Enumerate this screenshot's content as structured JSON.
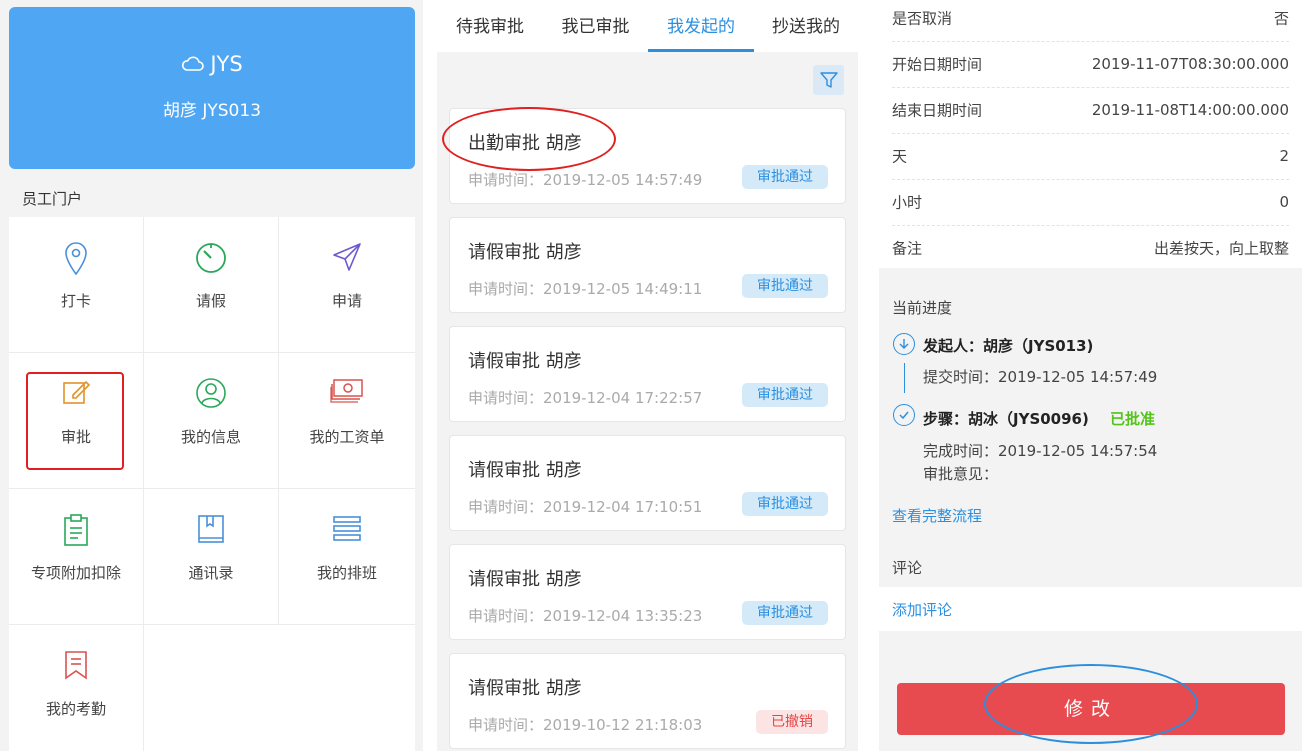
{
  "left": {
    "brand": "JYS",
    "user": "胡彦 JYS013",
    "section_label": "员工门户",
    "tiles": [
      {
        "label": "打卡",
        "icon": "location-pin-icon"
      },
      {
        "label": "请假",
        "icon": "timer-icon"
      },
      {
        "label": "申请",
        "icon": "send-icon"
      },
      {
        "label": "审批",
        "icon": "edit-icon"
      },
      {
        "label": "我的信息",
        "icon": "user-icon"
      },
      {
        "label": "我的工资单",
        "icon": "money-icon"
      },
      {
        "label": "专项附加扣除",
        "icon": "clipboard-icon"
      },
      {
        "label": "通讯录",
        "icon": "book-icon"
      },
      {
        "label": "我的排班",
        "icon": "schedule-icon"
      },
      {
        "label": "我的考勤",
        "icon": "bookmark-icon"
      }
    ]
  },
  "middle": {
    "tabs": [
      {
        "label": "待我审批"
      },
      {
        "label": "我已审批"
      },
      {
        "label": "我发起的"
      },
      {
        "label": "抄送我的"
      }
    ],
    "active_tab": "我发起的",
    "cards": [
      {
        "title": "出勤审批 胡彦",
        "meta": "申请时间：2019-12-05 14:57:49",
        "status": "审批通过",
        "status_type": "ok"
      },
      {
        "title": "请假审批 胡彦",
        "meta": "申请时间：2019-12-05 14:49:11",
        "status": "审批通过",
        "status_type": "ok"
      },
      {
        "title": "请假审批 胡彦",
        "meta": "申请时间：2019-12-04 17:22:57",
        "status": "审批通过",
        "status_type": "ok"
      },
      {
        "title": "请假审批 胡彦",
        "meta": "申请时间：2019-12-04 17:10:51",
        "status": "审批通过",
        "status_type": "ok"
      },
      {
        "title": "请假审批 胡彦",
        "meta": "申请时间：2019-12-04 13:35:23",
        "status": "审批通过",
        "status_type": "ok"
      },
      {
        "title": "请假审批 胡彦",
        "meta": "申请时间：2019-10-12 21:18:03",
        "status": "已撤销",
        "status_type": "cancel"
      }
    ]
  },
  "right": {
    "rows": [
      {
        "key": "是否取消",
        "value": "否"
      },
      {
        "key": "开始日期时间",
        "value": "2019-11-07T08:30:00.000"
      },
      {
        "key": "结束日期时间",
        "value": "2019-11-08T14:00:00.000"
      },
      {
        "key": "天",
        "value": "2"
      },
      {
        "key": "小时",
        "value": "0"
      },
      {
        "key": "备注",
        "value": "出差按天，向上取整"
      }
    ],
    "progress_label": "当前进度",
    "initiator": "发起人：胡彦（JYS013)",
    "submit_time": "提交时间：2019-12-05 14:57:49",
    "step": "步骤：胡冰（JYS0096)",
    "step_status": "已批准",
    "finish_time": "完成时间：2019-12-05 14:57:54",
    "opinion": "审批意见：",
    "view_flow": "查看完整流程",
    "comment_label": "评论",
    "add_comment": "添加评论",
    "edit_button": "修改"
  }
}
